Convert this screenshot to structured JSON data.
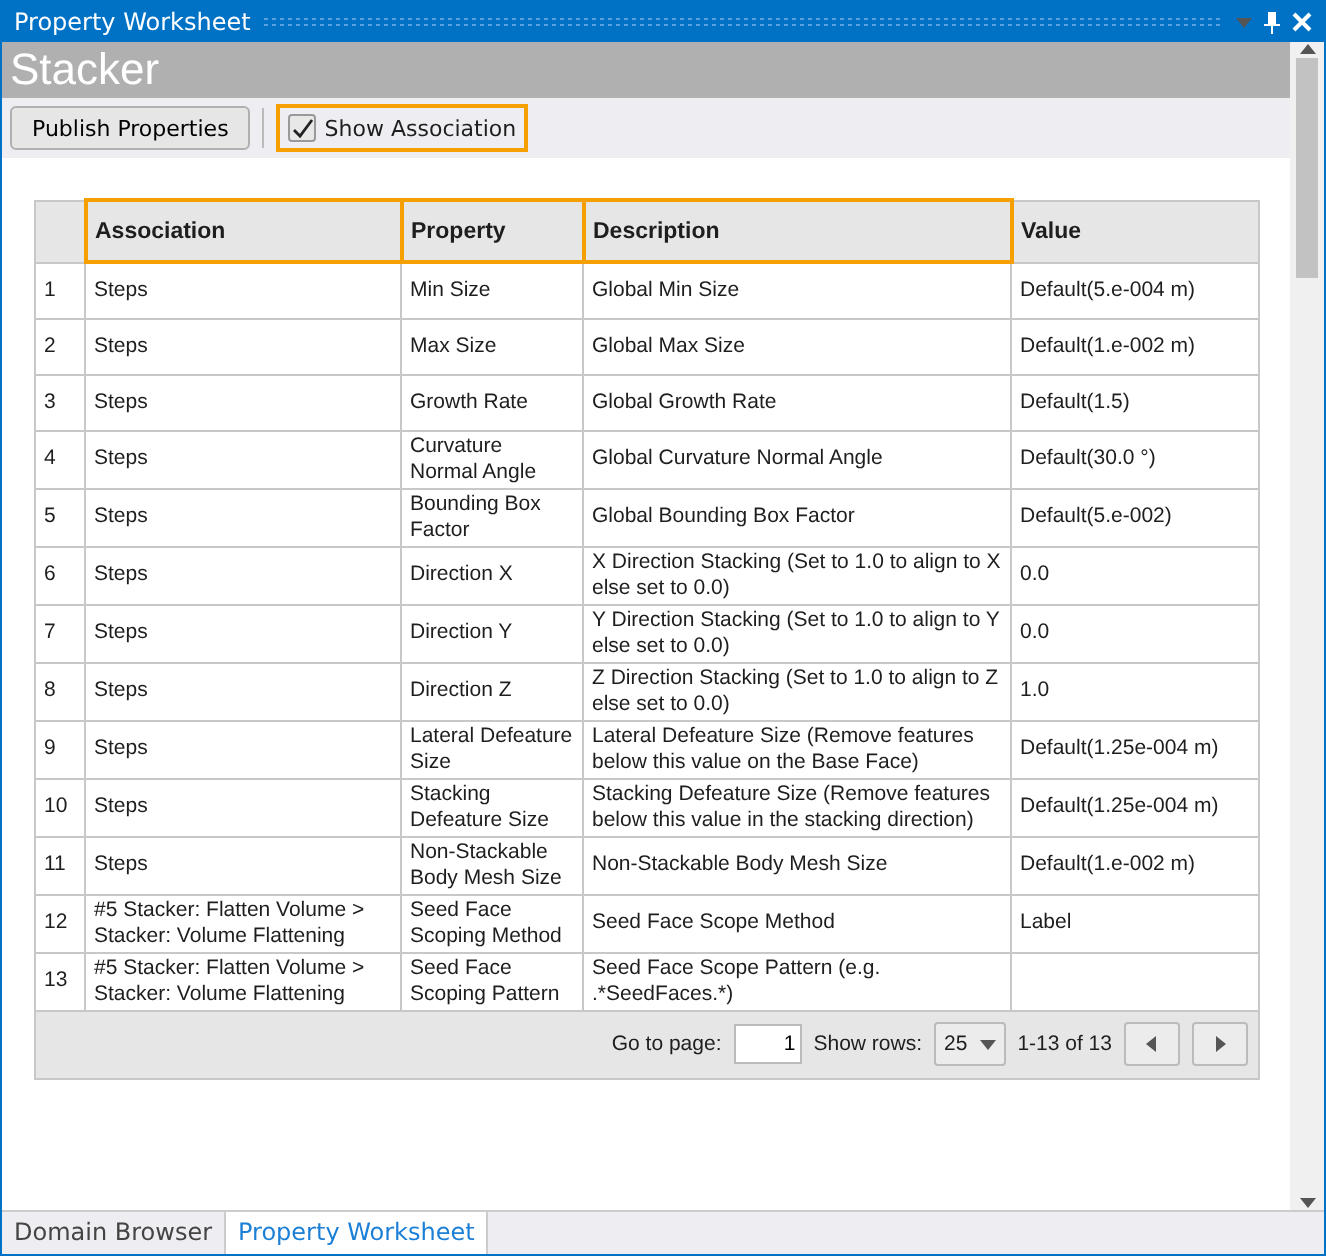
{
  "window": {
    "title": "Property Worksheet"
  },
  "header": {
    "title": "Stacker"
  },
  "toolbar": {
    "publish_button": "Publish Properties",
    "show_association": {
      "label": "Show Association",
      "checked": true,
      "highlighted": true
    }
  },
  "table": {
    "columns": [
      {
        "highlighted": false
      },
      {
        "label": "Association",
        "highlighted": true
      },
      {
        "label": "Property",
        "highlighted": true
      },
      {
        "label": "Description",
        "highlighted": true
      },
      {
        "label": "Value",
        "highlighted": false
      }
    ],
    "rows": [
      [
        "1",
        "Steps",
        "Min Size",
        "Global Min Size",
        "Default(5.e-004 m)"
      ],
      [
        "2",
        "Steps",
        "Max Size",
        "Global Max Size",
        "Default(1.e-002 m)"
      ],
      [
        "3",
        "Steps",
        "Growth Rate",
        "Global Growth Rate",
        "Default(1.5)"
      ],
      [
        "4",
        "Steps",
        "Curvature Normal Angle",
        "Global Curvature Normal Angle",
        "Default(30.0 °)"
      ],
      [
        "5",
        "Steps",
        "Bounding Box Factor",
        "Global Bounding Box Factor",
        "Default(5.e-002)"
      ],
      [
        "6",
        "Steps",
        "Direction X",
        "X Direction Stacking (Set to 1.0 to align to X else set to 0.0)",
        "0.0"
      ],
      [
        "7",
        "Steps",
        "Direction Y",
        "Y Direction Stacking (Set to 1.0 to align to Y else set to 0.0)",
        "0.0"
      ],
      [
        "8",
        "Steps",
        "Direction Z",
        "Z Direction Stacking (Set to 1.0 to align to Z else set to 0.0)",
        "1.0"
      ],
      [
        "9",
        "Steps",
        "Lateral Defeature Size",
        "Lateral Defeature Size (Remove features below this value on the Base Face)",
        "Default(1.25e-004 m)"
      ],
      [
        "10",
        "Steps",
        "Stacking Defeature Size",
        "Stacking Defeature Size (Remove features below this value in the stacking direction)",
        "Default(1.25e-004 m)"
      ],
      [
        "11",
        "Steps",
        "Non-Stackable Body Mesh Size",
        "Non-Stackable Body Mesh Size",
        "Default(1.e-002 m)"
      ],
      [
        "12",
        "#5 Stacker: Flatten Volume > Stacker: Volume Flattening",
        "Seed Face Scoping Method",
        "Seed Face Scope Method",
        "Label"
      ],
      [
        "13",
        "#5 Stacker: Flatten Volume > Stacker: Volume Flattening",
        "Seed Face Scoping Pattern",
        "Seed Face Scope Pattern (e.g. .*SeedFaces.*)",
        ""
      ]
    ]
  },
  "pagination": {
    "go_to_label": "Go to page:",
    "page": "1",
    "rows_label": "Show rows:",
    "rows_value": "25",
    "range": "1-13 of 13"
  },
  "bottom_tabs": [
    {
      "label": "Domain Browser",
      "selected": false
    },
    {
      "label": "Property Worksheet",
      "selected": true
    }
  ]
}
